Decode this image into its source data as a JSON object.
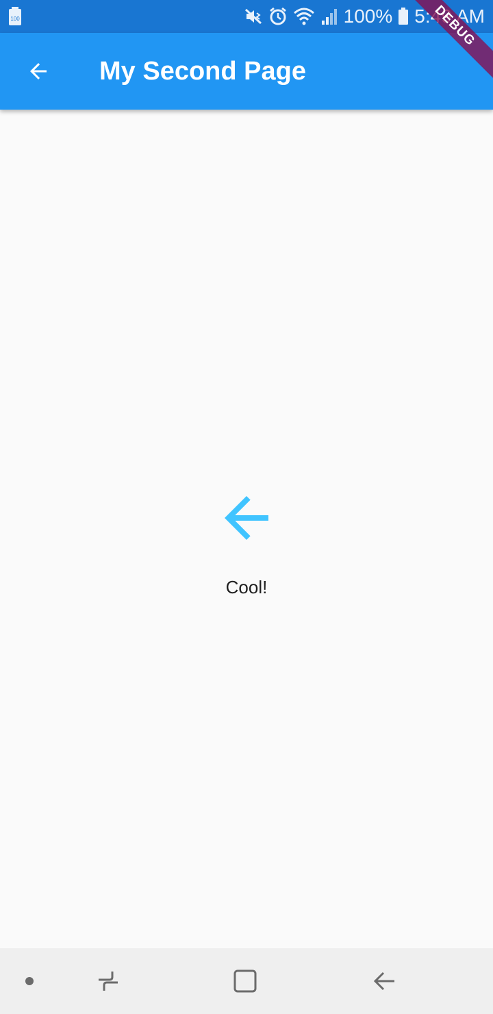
{
  "status_bar": {
    "battery_percent": "100%",
    "time": "5:49 AM",
    "icons": [
      "battery-saver-icon",
      "mute-vibrate-icon",
      "alarm-icon",
      "wifi-icon",
      "signal-icon",
      "battery-icon"
    ]
  },
  "app_bar": {
    "title": "My Second Page",
    "back_icon": "arrow-back-icon"
  },
  "debug_banner": {
    "label": "DEBUG"
  },
  "content": {
    "icon": "arrow-back-icon",
    "label": "Cool!"
  },
  "nav_bar": {
    "items": [
      "dot-icon",
      "recent-apps-icon",
      "home-icon",
      "back-icon"
    ]
  },
  "colors": {
    "status_bar": "#1976d2",
    "app_bar": "#2196f3",
    "content_icon": "#40c4ff",
    "background": "#fafafa",
    "nav_bar": "#efefef"
  }
}
